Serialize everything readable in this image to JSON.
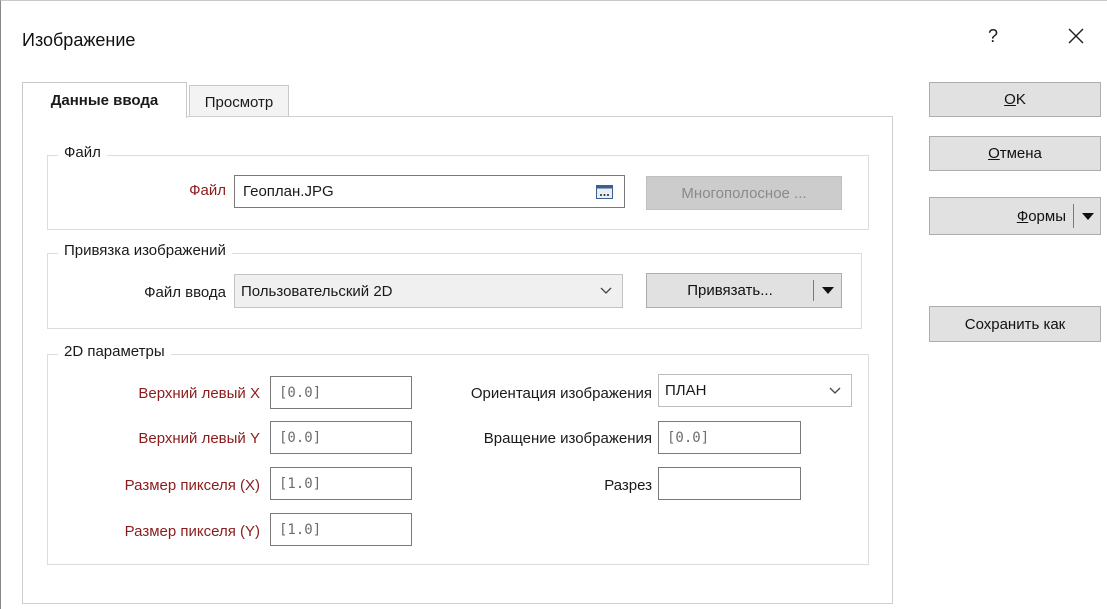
{
  "window": {
    "title": "Изображение",
    "help_glyph": "?",
    "close_glyph": "✕"
  },
  "tabs": [
    {
      "label": "Данные ввода",
      "active": true
    },
    {
      "label": "Просмотр",
      "active": false
    }
  ],
  "file_group": {
    "title": "Файл",
    "file_label": "Файл",
    "file_value": "Геоплан.JPG",
    "browse_icon": "browse-icon",
    "multiband_button": "Многополосное ..."
  },
  "binding_group": {
    "title": "Привязка изображений",
    "input_label": "Файл ввода",
    "input_value": "Пользовательский 2D",
    "bind_button": "Привязать..."
  },
  "params_group": {
    "title": "2D параметры",
    "top_left_x_label": "Верхний левый X",
    "top_left_x_value": "[0.0]",
    "top_left_y_label": "Верхний левый Y",
    "top_left_y_value": "[0.0]",
    "pixel_x_label": "Размер пикселя (X)",
    "pixel_x_value": "[1.0]",
    "pixel_y_label": "Размер пикселя (Y)",
    "pixel_y_value": "[1.0]",
    "orientation_label": "Ориентация изображения",
    "orientation_value": "ПЛАН",
    "rotation_label": "Вращение изображения",
    "rotation_value": "[0.0]",
    "section_label": "Разрез",
    "section_value": ""
  },
  "side_buttons": {
    "ok_mnemonic": "O",
    "ok_rest": "K",
    "cancel_mnemonic": "О",
    "cancel_rest": "тмена",
    "forms_mnemonic": "Ф",
    "forms_rest": "ормы",
    "save_as": "Сохранить как"
  },
  "colors": {
    "required_label": "#8b1c1c",
    "accent": "#0a246a"
  }
}
